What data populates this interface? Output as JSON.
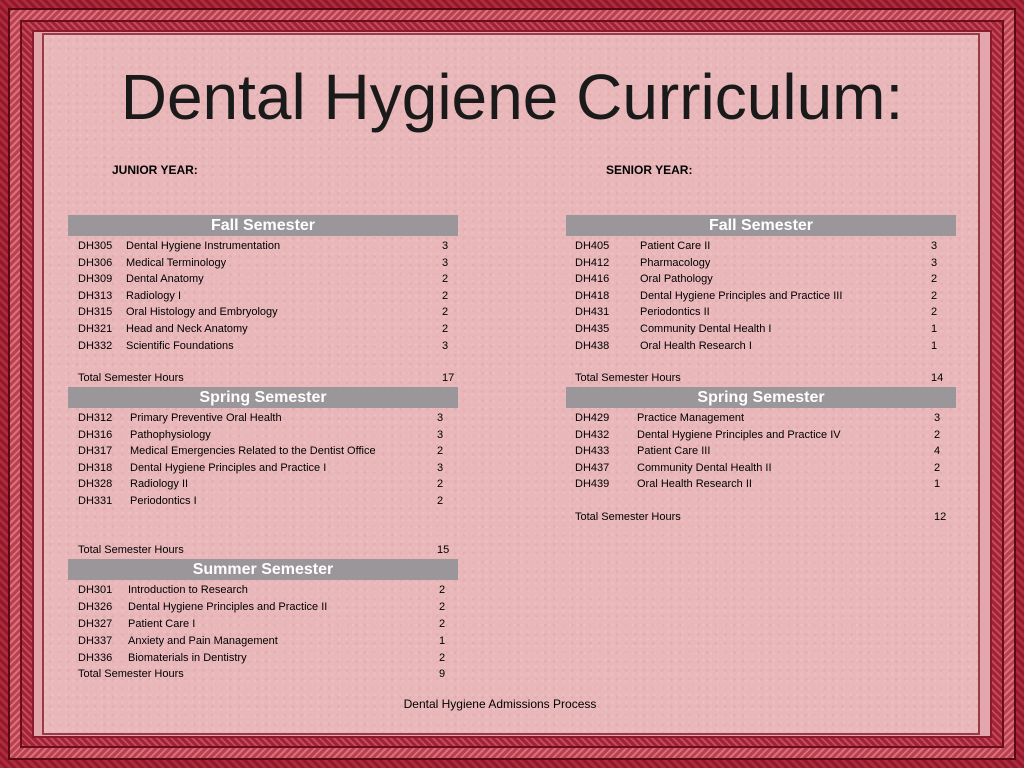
{
  "title": "Dental Hygiene Curriculum:",
  "junior_label": "JUNIOR YEAR:",
  "senior_label": "SENIOR YEAR:",
  "footer": "Dental Hygiene Admissions Process",
  "junior": {
    "fall": {
      "header": "Fall Semester",
      "courses": [
        {
          "code": "DH305",
          "name": "Dental Hygiene Instrumentation",
          "hours": "3"
        },
        {
          "code": "DH306",
          "name": "Medical Terminology",
          "hours": "3"
        },
        {
          "code": "DH309",
          "name": "Dental Anatomy",
          "hours": "2"
        },
        {
          "code": "DH313",
          "name": "Radiology I",
          "hours": "2"
        },
        {
          "code": "DH315",
          "name": "Oral Histology and Embryology",
          "hours": "2"
        },
        {
          "code": "DH321",
          "name": "Head and Neck Anatomy",
          "hours": "2"
        },
        {
          "code": "DH332",
          "name": "Scientific Foundations",
          "hours": "3"
        }
      ],
      "total_label": "Total Semester Hours",
      "total": "17"
    },
    "spring": {
      "header": "Spring Semester",
      "courses": [
        {
          "code": "DH312",
          "name": "Primary Preventive Oral Health",
          "hours": "3"
        },
        {
          "code": "DH316",
          "name": "Pathophysiology",
          "hours": "3"
        },
        {
          "code": "DH317",
          "name": "Medical Emergencies Related to the Dentist Office",
          "hours": "2"
        },
        {
          "code": "DH318",
          "name": "Dental Hygiene Principles and Practice I",
          "hours": "3"
        },
        {
          "code": "DH328",
          "name": "Radiology II",
          "hours": "2"
        },
        {
          "code": "DH331",
          "name": "Periodontics I",
          "hours": "2"
        }
      ],
      "total_label": "Total Semester Hours",
      "total": "15"
    },
    "summer": {
      "header": "Summer Semester",
      "courses": [
        {
          "code": "DH301",
          "name": "Introduction to Research",
          "hours": "2"
        },
        {
          "code": "DH326",
          "name": "Dental Hygiene Principles and Practice II",
          "hours": "2"
        },
        {
          "code": "DH327",
          "name": "Patient Care I",
          "hours": "2"
        },
        {
          "code": "DH337",
          "name": "Anxiety and Pain Management",
          "hours": "1"
        },
        {
          "code": "DH336",
          "name": "Biomaterials in Dentistry",
          "hours": "2"
        }
      ],
      "total_label": "Total Semester Hours",
      "total": "9"
    }
  },
  "senior": {
    "fall": {
      "header": "Fall Semester",
      "courses": [
        {
          "code": "DH405",
          "name": "Patient Care II",
          "hours": "3"
        },
        {
          "code": "DH412",
          "name": "Pharmacology",
          "hours": "3"
        },
        {
          "code": "DH416",
          "name": "Oral Pathology",
          "hours": "2"
        },
        {
          "code": "DH418",
          "name": "Dental Hygiene Principles and Practice III",
          "hours": "2"
        },
        {
          "code": "DH431",
          "name": "Periodontics II",
          "hours": "2"
        },
        {
          "code": "DH435",
          "name": "Community Dental Health I",
          "hours": "1"
        },
        {
          "code": "DH438",
          "name": "Oral Health Research I",
          "hours": "1"
        }
      ],
      "total_label": "Total Semester Hours",
      "total": "14"
    },
    "spring": {
      "header": "Spring Semester",
      "courses": [
        {
          "code": "DH429",
          "name": "Practice Management",
          "hours": "3"
        },
        {
          "code": "DH432",
          "name": "Dental Hygiene  Principles and Practice IV",
          "hours": "2"
        },
        {
          "code": "DH433",
          "name": "Patient Care III",
          "hours": "4"
        },
        {
          "code": "DH437",
          "name": "Community Dental Health II",
          "hours": "2"
        },
        {
          "code": "DH439",
          "name": "Oral Health Research II",
          "hours": "1"
        }
      ],
      "total_label": "Total Semester Hours",
      "total": "12"
    }
  }
}
